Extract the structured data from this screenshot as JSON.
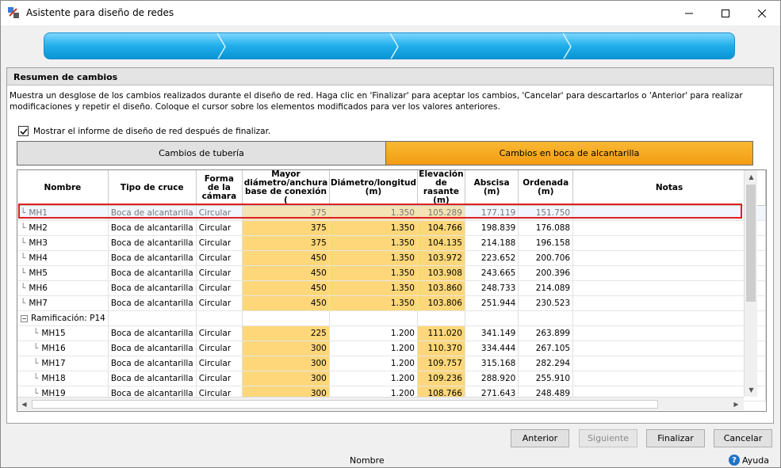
{
  "window": {
    "title": "Asistente para diseño de redes",
    "icons": [
      "app-icon",
      "minimize-icon",
      "maximize-icon",
      "close-icon"
    ]
  },
  "panel": {
    "title": "Resumen de cambios",
    "description": "Muestra un desglose de los cambios realizados durante el diseño de red. Haga clic en 'Finalizar' para aceptar los cambios, 'Cancelar' para descartarlos o 'Anterior' para realizar modificaciones y repetir el diseño. Coloque el cursor sobre los elementos modificados para ver los valores anteriores.",
    "checkbox_label": "Mostrar el informe de diseño de red después de finalizar.",
    "checkbox_checked": true
  },
  "tabs": [
    {
      "label": "Cambios de tubería",
      "active": false
    },
    {
      "label": "Cambios en boca de alcantarilla",
      "active": true
    }
  ],
  "table": {
    "headers": [
      "Nombre",
      "Tipo de cruce",
      "Forma de la cámara",
      "Mayor diámetro/anchura base de conexión (",
      "Diámetro/longitud (m)",
      "Elevación de rasante (m)",
      "Abscisa (m)",
      "Ordenada (m)",
      "Notas"
    ],
    "rows": [
      {
        "name": "MH1",
        "level": 1,
        "tipo": "Boca de alcantarilla",
        "forma": "Circular",
        "mayor": "375",
        "diam": "1.350",
        "elev": "105.289",
        "abscisa": "177.119",
        "ordenada": "151.750",
        "selected": true,
        "hl_mayor": true,
        "hl_diam": true,
        "hl_elev": true
      },
      {
        "name": "MH2",
        "level": 1,
        "tipo": "Boca de alcantarilla",
        "forma": "Circular",
        "mayor": "375",
        "diam": "1.350",
        "elev": "104.766",
        "abscisa": "198.839",
        "ordenada": "176.088",
        "hl_mayor": true,
        "hl_diam": true,
        "hl_elev": true
      },
      {
        "name": "MH3",
        "level": 1,
        "tipo": "Boca de alcantarilla",
        "forma": "Circular",
        "mayor": "375",
        "diam": "1.350",
        "elev": "104.135",
        "abscisa": "214.188",
        "ordenada": "196.158",
        "hl_mayor": true,
        "hl_diam": true,
        "hl_elev": true
      },
      {
        "name": "MH4",
        "level": 1,
        "tipo": "Boca de alcantarilla",
        "forma": "Circular",
        "mayor": "450",
        "diam": "1.350",
        "elev": "103.972",
        "abscisa": "223.652",
        "ordenada": "200.706",
        "hl_mayor": true,
        "hl_diam": true,
        "hl_elev": true
      },
      {
        "name": "MH5",
        "level": 1,
        "tipo": "Boca de alcantarilla",
        "forma": "Circular",
        "mayor": "450",
        "diam": "1.350",
        "elev": "103.908",
        "abscisa": "243.665",
        "ordenada": "200.396",
        "hl_mayor": true,
        "hl_diam": true,
        "hl_elev": true
      },
      {
        "name": "MH6",
        "level": 1,
        "tipo": "Boca de alcantarilla",
        "forma": "Circular",
        "mayor": "450",
        "diam": "1.350",
        "elev": "103.860",
        "abscisa": "248.733",
        "ordenada": "214.089",
        "hl_mayor": true,
        "hl_diam": true,
        "hl_elev": true
      },
      {
        "name": "MH7",
        "level": 1,
        "tipo": "Boca de alcantarilla",
        "forma": "Circular",
        "mayor": "450",
        "diam": "1.350",
        "elev": "103.806",
        "abscisa": "251.944",
        "ordenada": "230.523",
        "hl_mayor": true,
        "hl_diam": true,
        "hl_elev": true
      },
      {
        "name": "Ramificación: P14",
        "group": true
      },
      {
        "name": "MH15",
        "level": 2,
        "tipo": "Boca de alcantarilla",
        "forma": "Circular",
        "mayor": "225",
        "diam": "1.200",
        "elev": "111.020",
        "abscisa": "341.149",
        "ordenada": "263.899",
        "hl_mayor": true,
        "hl_diam": false,
        "hl_elev": true
      },
      {
        "name": "MH16",
        "level": 2,
        "tipo": "Boca de alcantarilla",
        "forma": "Circular",
        "mayor": "300",
        "diam": "1.200",
        "elev": "110.370",
        "abscisa": "334.444",
        "ordenada": "267.105",
        "hl_mayor": true,
        "hl_diam": false,
        "hl_elev": true
      },
      {
        "name": "MH17",
        "level": 2,
        "tipo": "Boca de alcantarilla",
        "forma": "Circular",
        "mayor": "300",
        "diam": "1.200",
        "elev": "109.757",
        "abscisa": "315.168",
        "ordenada": "282.294",
        "hl_mayor": true,
        "hl_diam": false,
        "hl_elev": true
      },
      {
        "name": "MH18",
        "level": 2,
        "tipo": "Boca de alcantarilla",
        "forma": "Circular",
        "mayor": "300",
        "diam": "1.200",
        "elev": "109.236",
        "abscisa": "288.920",
        "ordenada": "255.910",
        "hl_mayor": true,
        "hl_diam": false,
        "hl_elev": true
      },
      {
        "name": "MH19",
        "level": 2,
        "tipo": "Boca de alcantarilla",
        "forma": "Circular",
        "mayor": "300",
        "diam": "1.200",
        "elev": "108.766",
        "abscisa": "271.643",
        "ordenada": "248.489",
        "hl_mayor": true,
        "hl_diam": false,
        "hl_elev": true
      }
    ]
  },
  "buttons": {
    "back": "Anterior",
    "next": "Siguiente",
    "finish": "Finalizar",
    "cancel": "Cancelar"
  },
  "status": {
    "middle": "Nombre",
    "help": "Ayuda"
  },
  "colors": {
    "highlight": "#fdd77a",
    "active_tab": "#f39c12",
    "progress": "#1faeea",
    "selection_border": "#e02020"
  }
}
